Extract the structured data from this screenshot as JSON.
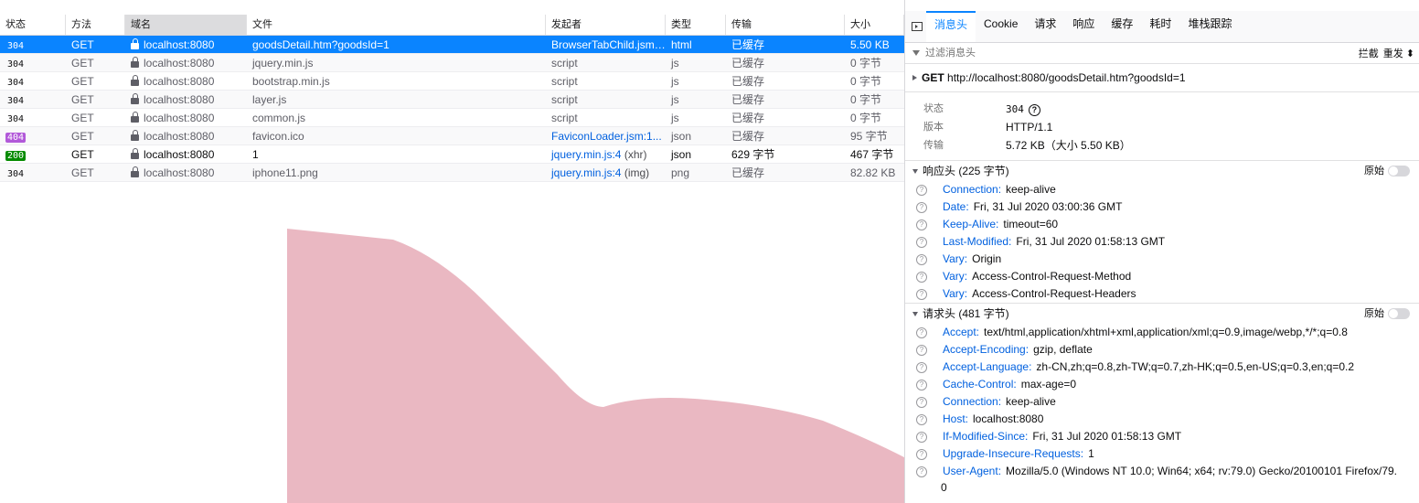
{
  "columns": {
    "status": "状态",
    "method": "方法",
    "domain": "域名",
    "file": "文件",
    "cause": "发起者",
    "type": "类型",
    "transferred": "传输",
    "size": "大小"
  },
  "requests": [
    {
      "status": "304",
      "method": "GET",
      "domain": "localhost:8080",
      "file": "goodsDetail.htm?goodsId=1",
      "cause": "BrowserTabChild.jsm:...",
      "cause_sub": "",
      "type": "html",
      "transferred": "已缓存",
      "size": "5.50 KB"
    },
    {
      "status": "304",
      "method": "GET",
      "domain": "localhost:8080",
      "file": "jquery.min.js",
      "cause": "script",
      "cause_sub": "",
      "type": "js",
      "transferred": "已缓存",
      "size": "0 字节"
    },
    {
      "status": "304",
      "method": "GET",
      "domain": "localhost:8080",
      "file": "bootstrap.min.js",
      "cause": "script",
      "cause_sub": "",
      "type": "js",
      "transferred": "已缓存",
      "size": "0 字节"
    },
    {
      "status": "304",
      "method": "GET",
      "domain": "localhost:8080",
      "file": "layer.js",
      "cause": "script",
      "cause_sub": "",
      "type": "js",
      "transferred": "已缓存",
      "size": "0 字节"
    },
    {
      "status": "304",
      "method": "GET",
      "domain": "localhost:8080",
      "file": "common.js",
      "cause": "script",
      "cause_sub": "",
      "type": "js",
      "transferred": "已缓存",
      "size": "0 字节"
    },
    {
      "status": "404",
      "method": "GET",
      "domain": "localhost:8080",
      "file": "favicon.ico",
      "cause": "FaviconLoader.jsm:1...",
      "cause_sub": "",
      "type": "json",
      "transferred": "已缓存",
      "size": "95 字节"
    },
    {
      "status": "200",
      "method": "GET",
      "domain": "localhost:8080",
      "file": "1",
      "cause": "jquery.min.js:4",
      "cause_sub": "(xhr)",
      "type": "json",
      "transferred": "629 字节",
      "size": "467 字节"
    },
    {
      "status": "304",
      "method": "GET",
      "domain": "localhost:8080",
      "file": "iphone11.png",
      "cause": "jquery.min.js:4",
      "cause_sub": "(img)",
      "type": "png",
      "transferred": "已缓存",
      "size": "82.82 KB"
    }
  ],
  "detail": {
    "tabs": [
      "消息头",
      "Cookie",
      "请求",
      "响应",
      "缓存",
      "耗时",
      "堆栈跟踪"
    ],
    "filter_placeholder": "过滤消息头",
    "block_label": "拦截",
    "resend_label": "重发",
    "request_method": "GET",
    "request_url": "http://localhost:8080/goodsDetail.htm?goodsId=1",
    "summary": {
      "status_key": "状态",
      "status_val": "304",
      "version_key": "版本",
      "version_val": "HTTP/1.1",
      "transferred_key": "传输",
      "transferred_val": "5.72 KB（大小 5.50 KB）"
    },
    "response_headers_title": "响应头 (225 字节)",
    "request_headers_title": "请求头 (481 字节)",
    "raw_label": "原始",
    "response_headers": [
      {
        "name": "Connection:",
        "value": "keep-alive"
      },
      {
        "name": "Date:",
        "value": "Fri, 31 Jul 2020 03:00:36 GMT"
      },
      {
        "name": "Keep-Alive:",
        "value": "timeout=60"
      },
      {
        "name": "Last-Modified:",
        "value": "Fri, 31 Jul 2020 01:58:13 GMT"
      },
      {
        "name": "Vary:",
        "value": "Origin"
      },
      {
        "name": "Vary:",
        "value": "Access-Control-Request-Method"
      },
      {
        "name": "Vary:",
        "value": "Access-Control-Request-Headers"
      }
    ],
    "request_headers": [
      {
        "name": "Accept:",
        "value": "text/html,application/xhtml+xml,application/xml;q=0.9,image/webp,*/*;q=0.8"
      },
      {
        "name": "Accept-Encoding:",
        "value": "gzip, deflate"
      },
      {
        "name": "Accept-Language:",
        "value": "zh-CN,zh;q=0.8,zh-TW;q=0.7,zh-HK;q=0.5,en-US;q=0.3,en;q=0.2"
      },
      {
        "name": "Cache-Control:",
        "value": "max-age=0"
      },
      {
        "name": "Connection:",
        "value": "keep-alive"
      },
      {
        "name": "Host:",
        "value": "localhost:8080"
      },
      {
        "name": "If-Modified-Since:",
        "value": "Fri, 31 Jul 2020 01:58:13 GMT"
      },
      {
        "name": "Upgrade-Insecure-Requests:",
        "value": "1"
      },
      {
        "name": "User-Agent:",
        "value": "Mozilla/5.0 (Windows NT 10.0; Win64; x64; rv:79.0) Gecko/20100101 Firefox/79."
      }
    ],
    "user_agent_wrap": "0"
  },
  "colors": {
    "accent": "#0a84ff",
    "status_404": "#b259d9",
    "status_200": "#058b00",
    "preview_blob": "#eab8c2"
  }
}
